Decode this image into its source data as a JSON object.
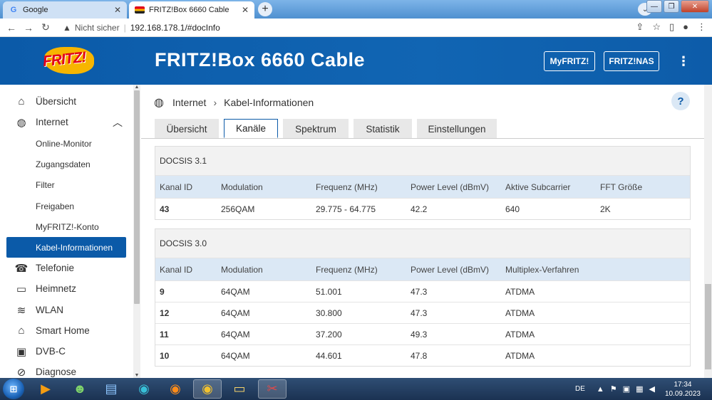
{
  "browser": {
    "tabs": [
      {
        "title": "Google",
        "favicon": "google-icon",
        "active": false
      },
      {
        "title": "FRITZ!Box 6660 Cable",
        "favicon": "fritzbox-icon",
        "active": true
      }
    ],
    "not_secure": "Nicht sicher",
    "url": "192.168.178.1/#docInfo"
  },
  "header": {
    "logo_text": "FRITZ!",
    "title": "FRITZ!Box 6660 Cable",
    "myfritz_label": "MyFRITZ!",
    "fritznas_label": "FRITZ!NAS"
  },
  "sidebar": {
    "items": [
      {
        "label": "Übersicht",
        "icon": "home-icon"
      },
      {
        "label": "Internet",
        "icon": "globe-icon"
      },
      {
        "label": "Online-Monitor"
      },
      {
        "label": "Zugangsdaten"
      },
      {
        "label": "Filter"
      },
      {
        "label": "Freigaben"
      },
      {
        "label": "MyFRITZ!-Konto"
      },
      {
        "label": "Kabel-Informationen"
      },
      {
        "label": "Telefonie",
        "icon": "phone-icon"
      },
      {
        "label": "Heimnetz",
        "icon": "network-icon"
      },
      {
        "label": "WLAN",
        "icon": "wifi-icon"
      },
      {
        "label": "Smart Home",
        "icon": "smart-home-icon"
      },
      {
        "label": "DVB-C",
        "icon": "tv-icon"
      },
      {
        "label": "Diagnose",
        "icon": "diagnose-icon"
      }
    ]
  },
  "breadcrumb": {
    "first": "Internet",
    "second": "Kabel-Informationen",
    "help": "?"
  },
  "tabs": [
    {
      "label": "Übersicht"
    },
    {
      "label": "Kanäle"
    },
    {
      "label": "Spektrum"
    },
    {
      "label": "Statistik"
    },
    {
      "label": "Einstellungen"
    }
  ],
  "docsis31": {
    "title": "DOCSIS 3.1",
    "headers": [
      "Kanal ID",
      "Modulation",
      "Frequenz (MHz)",
      "Power Level (dBmV)",
      "Aktive Subcarrier",
      "FFT Größe"
    ],
    "rows": [
      [
        "43",
        "256QAM",
        "29.775 - 64.775",
        "42.2",
        "640",
        "2K"
      ]
    ]
  },
  "docsis30": {
    "title": "DOCSIS 3.0",
    "headers": [
      "Kanal ID",
      "Modulation",
      "Frequenz (MHz)",
      "Power Level (dBmV)",
      "Multiplex-Verfahren"
    ],
    "rows": [
      [
        "9",
        "64QAM",
        "51.001",
        "47.3",
        "ATDMA"
      ],
      [
        "12",
        "64QAM",
        "30.800",
        "47.3",
        "ATDMA"
      ],
      [
        "11",
        "64QAM",
        "37.200",
        "49.3",
        "ATDMA"
      ],
      [
        "10",
        "64QAM",
        "44.601",
        "47.8",
        "ATDMA"
      ]
    ]
  },
  "taskbar": {
    "language": "DE",
    "time": "17:34",
    "date": "10.09.2023"
  },
  "colors": {
    "brand_blue": "#0b5aa8",
    "table_header": "#dbe8f5",
    "active_tab_border": "#0b5aa8"
  }
}
